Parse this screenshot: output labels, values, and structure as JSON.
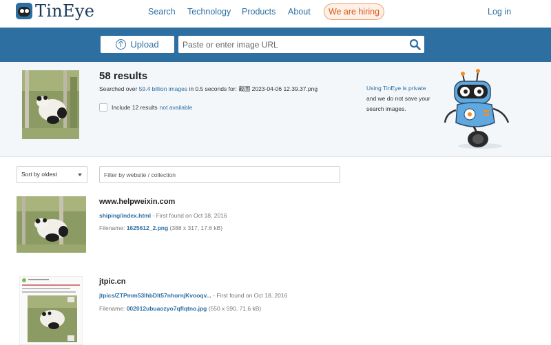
{
  "brand": {
    "name": "TinEye"
  },
  "nav": {
    "search": "Search",
    "technology": "Technology",
    "products": "Products",
    "about": "About",
    "hiring": "We are hiring",
    "login": "Log in"
  },
  "search_bar": {
    "upload_label": "Upload",
    "url_placeholder": "Paste or enter image URL"
  },
  "summary": {
    "count_label": "58 results",
    "searched_prefix": "Searched over ",
    "index_size": "59.4 billion images",
    "searched_middle": " in 0.5 seconds for: ",
    "query_filename": "截圖 2023-04-06 12.39.37.png",
    "include_prefix": "Include 12 results",
    "include_link": "not available",
    "include_checked": false
  },
  "privacy": {
    "link": "Using TinEye is private",
    "text": "and we do not save your search images."
  },
  "filters": {
    "sort_value": "Sort by oldest",
    "filter_placeholder": "Filter by website / collection"
  },
  "results": [
    {
      "domain": "www.helpweixin.com",
      "page": "shiping/index.html",
      "first_found": " - First found on Oct 18, 2016",
      "filename_label": "Filename: ",
      "filename": "1625612_2.png",
      "dims": " (388 x 317, 17.6 kB)"
    },
    {
      "domain": "jtpic.cn",
      "page": "jtpics/ZTPmm53lhbDlt57nhornjKvooqv...",
      "first_found": " - First found on Oct 18, 2016",
      "filename_label": "Filename: ",
      "filename": "002012ubuaozyo7qflqtno.jpg",
      "dims": " (550 x 590, 71.6 kB)"
    }
  ],
  "colors": {
    "brand_blue": "#2e6fa1",
    "link_blue": "#2c6ea3",
    "hiring_orange": "#d9591b"
  }
}
